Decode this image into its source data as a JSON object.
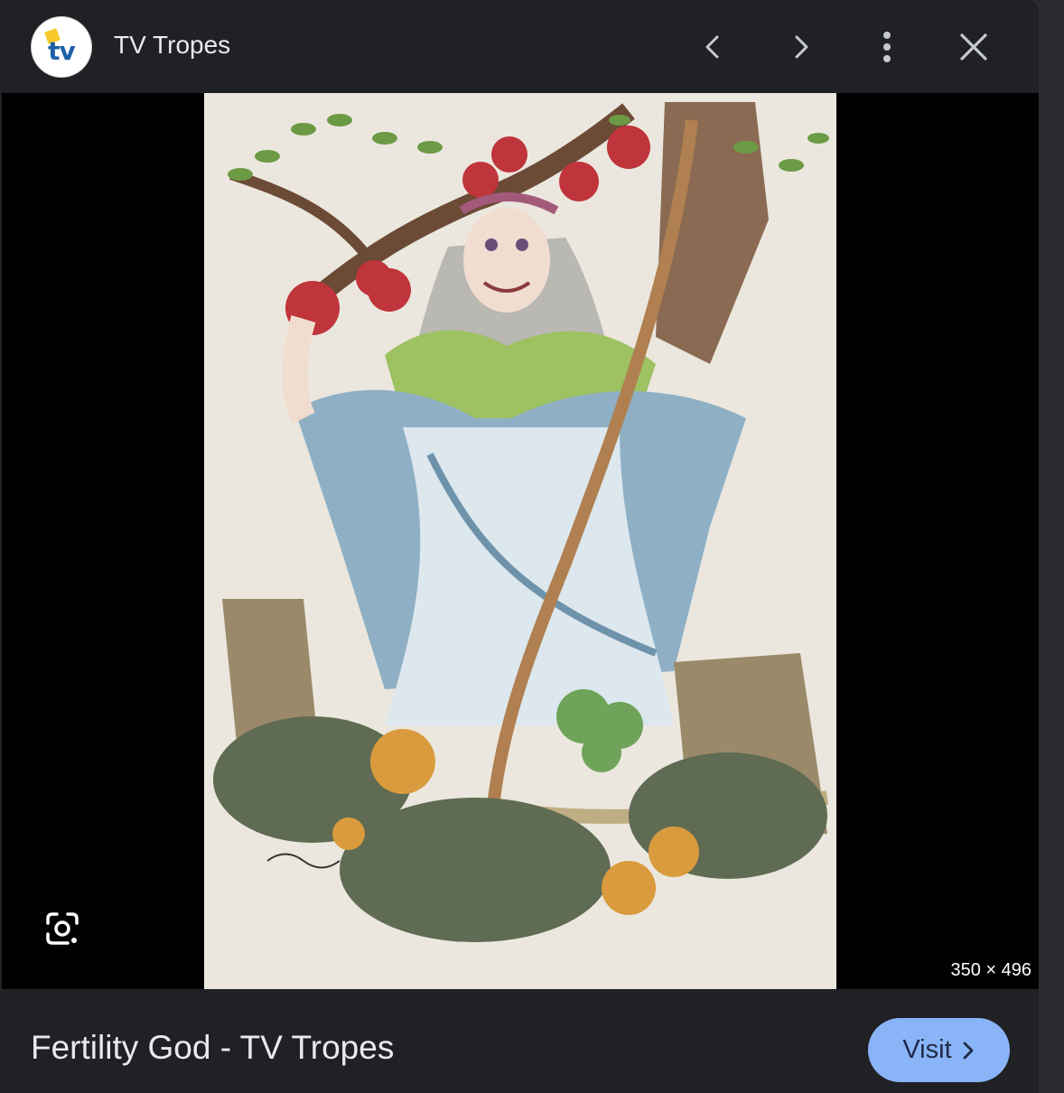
{
  "header": {
    "site_name": "TV Tropes",
    "logo_text": "tv",
    "icons": {
      "back": "chevron-left-icon",
      "forward": "chevron-right-icon",
      "more": "more-vert-icon",
      "close": "close-icon"
    }
  },
  "viewer": {
    "image_dimensions": "350 × 496",
    "lens_icon": "google-lens-icon"
  },
  "footer": {
    "title": "Fertility God - TV Tropes",
    "visit_label": "Visit",
    "visit_icon": "chevron-right-icon"
  },
  "colors": {
    "background": "#202124",
    "accent": "#8ab4f8",
    "text": "#e8eaed"
  }
}
